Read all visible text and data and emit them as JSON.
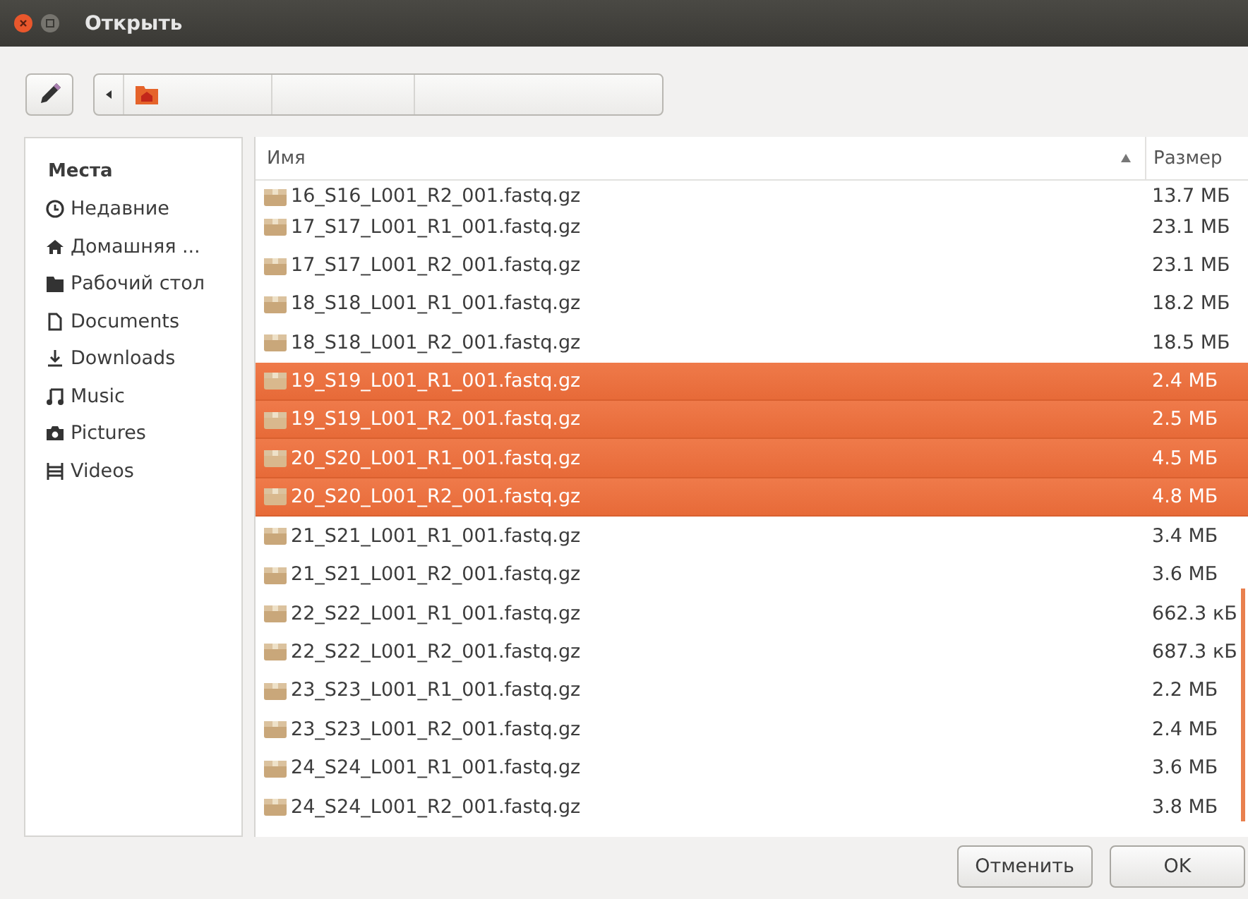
{
  "window": {
    "title": "Открыть"
  },
  "sidebar": {
    "heading": "Места",
    "items": [
      {
        "label": "Недавние",
        "kind": "recent",
        "selected": false
      },
      {
        "label": "Домашняя ...",
        "kind": "home",
        "selected": false
      },
      {
        "label": "Рабочий стол",
        "kind": "desktop",
        "selected": false
      },
      {
        "label": "Documents",
        "kind": "document",
        "selected": false
      },
      {
        "label": "Downloads",
        "kind": "download",
        "selected": false
      },
      {
        "label": "Music",
        "kind": "music",
        "selected": false
      },
      {
        "label": "Pictures",
        "kind": "camera",
        "selected": false
      },
      {
        "label": "Videos",
        "kind": "video",
        "selected": false
      }
    ]
  },
  "table": {
    "columns": [
      "Имя",
      "Размер"
    ],
    "rows": [
      {
        "name": "16_S16_L001_R2_001.fastq.gz",
        "size": "13.7 МБ",
        "selected": false
      },
      {
        "name": "17_S17_L001_R1_001.fastq.gz",
        "size": "23.1 МБ",
        "selected": false
      },
      {
        "name": "17_S17_L001_R2_001.fastq.gz",
        "size": "23.1 МБ",
        "selected": false
      },
      {
        "name": "18_S18_L001_R1_001.fastq.gz",
        "size": "18.2 МБ",
        "selected": false
      },
      {
        "name": "18_S18_L001_R2_001.fastq.gz",
        "size": "18.5 МБ",
        "selected": false
      },
      {
        "name": "19_S19_L001_R1_001.fastq.gz",
        "size": "2.4 МБ",
        "selected": true
      },
      {
        "name": "19_S19_L001_R2_001.fastq.gz",
        "size": "2.5 МБ",
        "selected": true
      },
      {
        "name": "20_S20_L001_R1_001.fastq.gz",
        "size": "4.5 МБ",
        "selected": true
      },
      {
        "name": "20_S20_L001_R2_001.fastq.gz",
        "size": "4.8 МБ",
        "selected": true
      },
      {
        "name": "21_S21_L001_R1_001.fastq.gz",
        "size": "3.4 МБ",
        "selected": false
      },
      {
        "name": "21_S21_L001_R2_001.fastq.gz",
        "size": "3.6 МБ",
        "selected": false
      },
      {
        "name": "22_S22_L001_R1_001.fastq.gz",
        "size": "662.3 кБ",
        "selected": false
      },
      {
        "name": "22_S22_L001_R2_001.fastq.gz",
        "size": "687.3 кБ",
        "selected": false
      },
      {
        "name": "23_S23_L001_R1_001.fastq.gz",
        "size": "2.2 МБ",
        "selected": false
      },
      {
        "name": "23_S23_L001_R2_001.fastq.gz",
        "size": "2.4 МБ",
        "selected": false
      },
      {
        "name": "24_S24_L001_R1_001.fastq.gz",
        "size": "3.6 МБ",
        "selected": false
      },
      {
        "name": "24_S24_L001_R2_001.fastq.gz",
        "size": "3.8 МБ",
        "selected": false
      }
    ]
  },
  "buttons": [
    {
      "label": "Отменить",
      "kind": "cancel"
    },
    {
      "label": "OK",
      "kind": "ok"
    }
  ]
}
